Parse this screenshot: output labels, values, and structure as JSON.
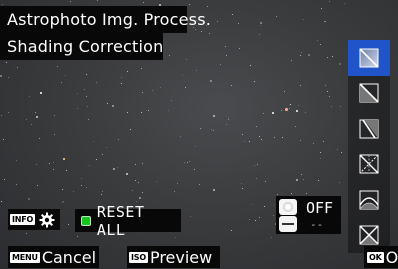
{
  "header": {
    "app_title": "Astrophoto Img. Process.",
    "screen_title": "Shading Correction"
  },
  "sidebar": {
    "items": [
      {
        "icon": "gradient-correction-icon",
        "selected": true
      },
      {
        "icon": "gradient-diagonal-icon",
        "selected": false
      },
      {
        "icon": "gradient-vertical-icon",
        "selected": false
      },
      {
        "icon": "gradient-radial-icon",
        "selected": false
      },
      {
        "icon": "gradient-curved-icon",
        "selected": false
      },
      {
        "icon": "gradient-cross-icon",
        "selected": false
      }
    ],
    "selected_color": "#1f55c8"
  },
  "controls": {
    "info_tag": "INFO",
    "reset_label": "RESET ALL",
    "reset_indicator_color": "#17c61d"
  },
  "exposure_panel": {
    "value": "OFF",
    "secondary": "--"
  },
  "bottom_bar": {
    "menu_tag": "MENU",
    "menu_label": "Cancel",
    "iso_tag": "ISO",
    "iso_label": "Preview",
    "ok_tag": "OK",
    "ok_label": "OK"
  }
}
